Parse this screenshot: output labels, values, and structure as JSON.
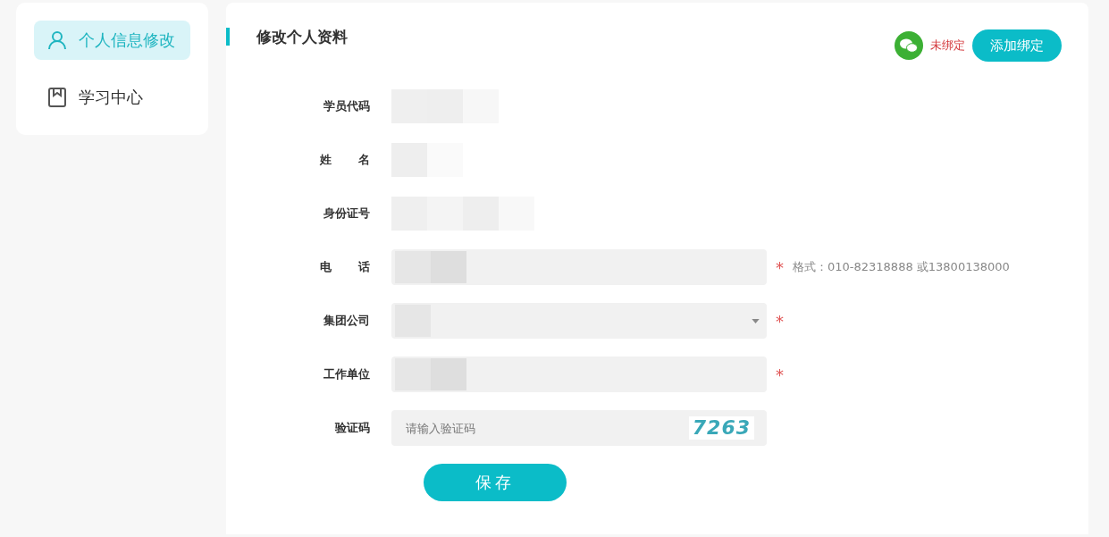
{
  "sidebar": {
    "items": [
      {
        "label": "个人信息修改",
        "kind": "person",
        "selected": true
      },
      {
        "label": "学习中心",
        "kind": "book",
        "selected": false
      }
    ]
  },
  "page": {
    "title": "修改个人资料"
  },
  "wechat": {
    "status": "未绑定",
    "bound": false,
    "button": "添加绑定"
  },
  "form": {
    "fields": [
      {
        "label": "学员代码",
        "kind": "static",
        "spread": false
      },
      {
        "label": "姓名",
        "kind": "static",
        "spread": true
      },
      {
        "label": "身份证号",
        "kind": "static",
        "spread": false
      },
      {
        "label": "电话",
        "kind": "input",
        "spread": true,
        "required_mark": "*",
        "hint": "格式：010-82318888 或13800138000"
      },
      {
        "label": "集团公司",
        "kind": "select",
        "spread": false,
        "required_mark": "*"
      },
      {
        "label": "工作单位",
        "kind": "input",
        "spread": false,
        "required_mark": "*"
      },
      {
        "label": "验证码",
        "kind": "captcha",
        "spread": false,
        "placeholder": "请输入验证码",
        "captcha": "7263"
      }
    ],
    "submit": "保存"
  }
}
